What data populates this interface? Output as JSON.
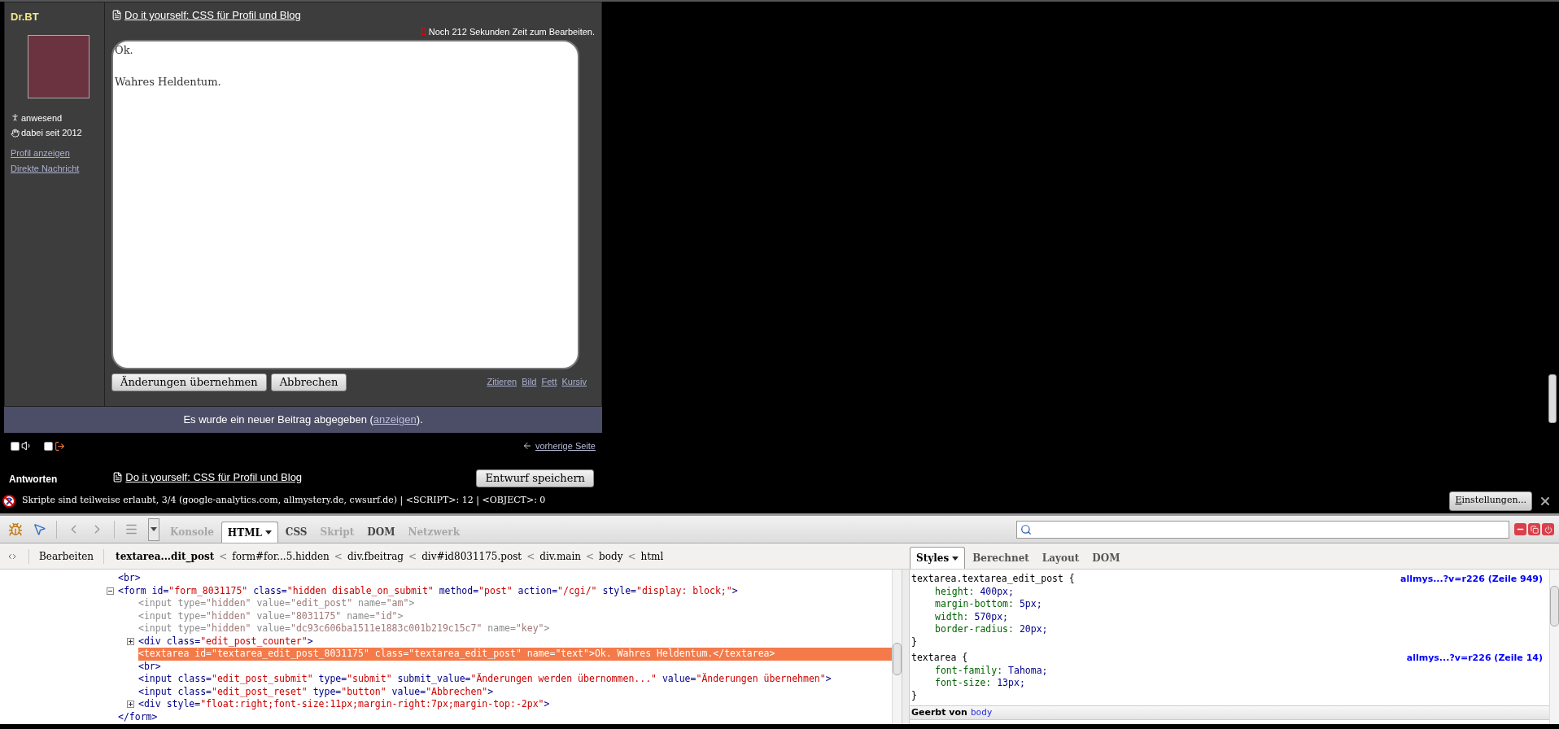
{
  "forum": {
    "author": {
      "name": "Dr.BT",
      "status": "anwesend",
      "member_since": "dabei seit 2012",
      "links": [
        "Profil anzeigen",
        "Direkte Nachricht"
      ]
    },
    "post": {
      "title": "Do it yourself: CSS für Profil und Blog",
      "edit_timer": "Noch 212 Sekunden Zeit zum Bearbeiten.",
      "textarea_value": "Ok.\n\nWahres Heldentum.",
      "buttons": [
        "Änderungen übernehmen",
        "Abbrechen"
      ],
      "format_links": [
        "Zitieren",
        "Bild",
        "Fett",
        "Kursiv"
      ]
    },
    "notice": {
      "before": "Es wurde ein neuer Beitrag abgegeben (",
      "link": "anzeigen",
      "after": ")."
    },
    "options": [
      {
        "kind": "sound",
        "checked": false
      },
      {
        "kind": "exit",
        "checked": false
      }
    ],
    "previous_page": "vorherige Seite",
    "reply": {
      "label": "Antworten",
      "title": "Do it yourself: CSS für Profil und Blog",
      "button": "Entwurf speichern"
    }
  },
  "noscript_bar": {
    "message": "Skripte sind teilweise erlaubt, 3/4 (google-analytics.com, allmystery.de, cwsurf.de) | <SCRIPT>: 12 | <OBJECT>: 0",
    "settings_button": "Einstellungen..."
  },
  "devtools": {
    "tabs": [
      {
        "label": "Konsole",
        "selected": false,
        "disabled": true,
        "menu": false
      },
      {
        "label": "HTML",
        "selected": true,
        "disabled": false,
        "menu": true
      },
      {
        "label": "CSS",
        "selected": false,
        "disabled": false,
        "menu": false
      },
      {
        "label": "Skript",
        "selected": false,
        "disabled": true,
        "menu": false
      },
      {
        "label": "DOM",
        "selected": false,
        "disabled": false,
        "menu": false
      },
      {
        "label": "Netzwerk",
        "selected": false,
        "disabled": true,
        "menu": false
      }
    ],
    "edit_button": "Bearbeiten",
    "breadcrumbs": [
      {
        "kind": "crumb",
        "text": "textarea...dit_post",
        "selected": true
      },
      {
        "kind": "separator",
        "text": "<"
      },
      {
        "kind": "crumb",
        "text": "form#for...5.hidden",
        "selected": false
      },
      {
        "kind": "separator",
        "text": "<"
      },
      {
        "kind": "crumb",
        "text": "div.fbeitrag",
        "selected": false
      },
      {
        "kind": "separator",
        "text": "<"
      },
      {
        "kind": "crumb",
        "text": "div#id8031175.post",
        "selected": false
      },
      {
        "kind": "separator",
        "text": "<"
      },
      {
        "kind": "crumb",
        "text": "div.main",
        "selected": false
      },
      {
        "kind": "separator",
        "text": "<"
      },
      {
        "kind": "crumb",
        "text": "body",
        "selected": false
      },
      {
        "kind": "separator",
        "text": "<"
      },
      {
        "kind": "crumb",
        "text": "html",
        "selected": false
      }
    ],
    "side_tabs": [
      {
        "label": "Styles",
        "selected": true,
        "menu": true
      },
      {
        "label": "Berechnet",
        "selected": false,
        "menu": false
      },
      {
        "label": "Layout",
        "selected": false,
        "menu": false
      },
      {
        "label": "DOM",
        "selected": false,
        "menu": false
      }
    ],
    "html_tree": [
      {
        "tokens": [
          {
            "kind": "tag",
            "text": "<br>"
          }
        ],
        "selected": false,
        "muted": false
      },
      {
        "tokens": [
          {
            "kind": "tag",
            "text": "<form"
          },
          {
            "kind": "attr",
            "text": " id="
          },
          {
            "kind": "value",
            "text": "\"form_8031175\""
          },
          {
            "kind": "attr",
            "text": " class="
          },
          {
            "kind": "value",
            "text": "\"hidden disable_on_submit\""
          },
          {
            "kind": "attr",
            "text": " method="
          },
          {
            "kind": "value",
            "text": "\"post\""
          },
          {
            "kind": "attr",
            "text": " action="
          },
          {
            "kind": "value",
            "text": "\"/cgi/\""
          },
          {
            "kind": "attr",
            "text": " style="
          },
          {
            "kind": "value",
            "text": "\"display: block;\""
          },
          {
            "kind": "tag",
            "text": ">"
          }
        ],
        "selected": false,
        "muted": false,
        "expanded": true,
        "children": [
          {
            "tokens": [
              {
                "kind": "tag",
                "text": "<input"
              },
              {
                "kind": "attr",
                "text": " type="
              },
              {
                "kind": "value",
                "text": "\"hidden\""
              },
              {
                "kind": "attr",
                "text": " value="
              },
              {
                "kind": "value",
                "text": "\"edit_post\""
              },
              {
                "kind": "attr",
                "text": " name="
              },
              {
                "kind": "value",
                "text": "\"am\""
              },
              {
                "kind": "tag",
                "text": ">"
              }
            ],
            "selected": false,
            "muted": true
          },
          {
            "tokens": [
              {
                "kind": "tag",
                "text": "<input"
              },
              {
                "kind": "attr",
                "text": " type="
              },
              {
                "kind": "value",
                "text": "\"hidden\""
              },
              {
                "kind": "attr",
                "text": " value="
              },
              {
                "kind": "value",
                "text": "\"8031175\""
              },
              {
                "kind": "attr",
                "text": " name="
              },
              {
                "kind": "value",
                "text": "\"id\""
              },
              {
                "kind": "tag",
                "text": ">"
              }
            ],
            "selected": false,
            "muted": true
          },
          {
            "tokens": [
              {
                "kind": "tag",
                "text": "<input"
              },
              {
                "kind": "attr",
                "text": " type="
              },
              {
                "kind": "value",
                "text": "\"hidden\""
              },
              {
                "kind": "attr",
                "text": " value="
              },
              {
                "kind": "value",
                "text": "\"dc93c606ba1511e1883c001b219c15c7\""
              },
              {
                "kind": "attr",
                "text": " name="
              },
              {
                "kind": "value",
                "text": "\"key\""
              },
              {
                "kind": "tag",
                "text": ">"
              }
            ],
            "selected": false,
            "muted": true
          },
          {
            "tokens": [
              {
                "kind": "tag",
                "text": "<div"
              },
              {
                "kind": "attr",
                "text": " class="
              },
              {
                "kind": "value",
                "text": "\"edit_post_counter\""
              },
              {
                "kind": "tag",
                "text": ">"
              }
            ],
            "selected": false,
            "muted": false,
            "expanded": false
          },
          {
            "tokens": [
              {
                "kind": "tag",
                "text": "<textarea"
              },
              {
                "kind": "attr",
                "text": " id="
              },
              {
                "kind": "value",
                "text": "\"textarea_edit_post_8031175\""
              },
              {
                "kind": "attr",
                "text": " class="
              },
              {
                "kind": "value",
                "text": "\"textarea_edit_post\""
              },
              {
                "kind": "attr",
                "text": " name="
              },
              {
                "kind": "value",
                "text": "\"text\""
              },
              {
                "kind": "tag",
                "text": ">"
              },
              {
                "kind": "text",
                "text": "Ok. Wahres Heldentum."
              },
              {
                "kind": "tag",
                "text": "</textarea>"
              }
            ],
            "selected": true,
            "muted": false
          },
          {
            "tokens": [
              {
                "kind": "tag",
                "text": "<br>"
              }
            ],
            "selected": false,
            "muted": false
          },
          {
            "tokens": [
              {
                "kind": "tag",
                "text": "<input"
              },
              {
                "kind": "attr",
                "text": " class="
              },
              {
                "kind": "value",
                "text": "\"edit_post_submit\""
              },
              {
                "kind": "attr",
                "text": " type="
              },
              {
                "kind": "value",
                "text": "\"submit\""
              },
              {
                "kind": "attr",
                "text": " submit_value="
              },
              {
                "kind": "value",
                "text": "\"Änderungen werden übernommen...\""
              },
              {
                "kind": "attr",
                "text": " value="
              },
              {
                "kind": "value",
                "text": "\"Änderungen übernehmen\""
              },
              {
                "kind": "tag",
                "text": ">"
              }
            ],
            "selected": false,
            "muted": false
          },
          {
            "tokens": [
              {
                "kind": "tag",
                "text": "<input"
              },
              {
                "kind": "attr",
                "text": " class="
              },
              {
                "kind": "value",
                "text": "\"edit_post_reset\""
              },
              {
                "kind": "attr",
                "text": " type="
              },
              {
                "kind": "value",
                "text": "\"button\""
              },
              {
                "kind": "attr",
                "text": " value="
              },
              {
                "kind": "value",
                "text": "\"Abbrechen\""
              },
              {
                "kind": "tag",
                "text": ">"
              }
            ],
            "selected": false,
            "muted": false
          },
          {
            "tokens": [
              {
                "kind": "tag",
                "text": "<div"
              },
              {
                "kind": "attr",
                "text": " style="
              },
              {
                "kind": "value",
                "text": "\"float:right;font-size:11px;margin-right:7px;margin-top:-2px\""
              },
              {
                "kind": "tag",
                "text": ">"
              }
            ],
            "selected": false,
            "muted": false,
            "expanded": false
          }
        ],
        "closing": [
          {
            "kind": "tag",
            "text": "</form>"
          }
        ]
      }
    ],
    "css_rules": [
      {
        "selector": "textarea.textarea_edit_post {",
        "source": "allmys...?v=r226 (Zeile 949)",
        "properties": [
          {
            "name": "height:",
            "value": "400px;"
          },
          {
            "name": "margin-bottom:",
            "value": "5px;"
          },
          {
            "name": "width:",
            "value": "570px;"
          },
          {
            "name": "border-radius:",
            "value": "20px;"
          }
        ],
        "close": "}"
      },
      {
        "selector": "textarea {",
        "source": "allmys...?v=r226 (Zeile 14)",
        "properties": [
          {
            "name": "font-family:",
            "value": "Tahoma;"
          },
          {
            "name": "font-size:",
            "value": "13px;"
          }
        ],
        "close": "}"
      }
    ],
    "inherited": {
      "label": "Geerbt von",
      "element": "body"
    }
  }
}
